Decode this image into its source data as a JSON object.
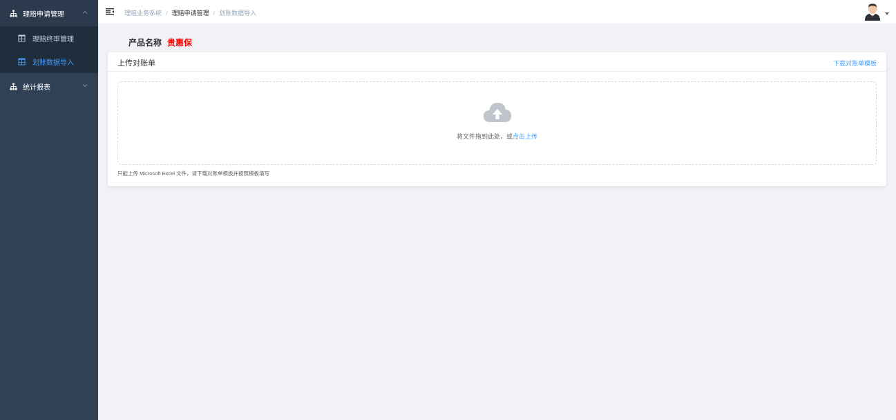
{
  "sidebar": {
    "groups": [
      {
        "label": "理赔申请管理",
        "items": [
          {
            "label": "理赔终审管理"
          },
          {
            "label": "划账数据导入"
          }
        ]
      },
      {
        "label": "统计报表"
      }
    ]
  },
  "header": {
    "breadcrumb": [
      "理赔业务系统",
      "理赔申请管理",
      "划账数据导入"
    ]
  },
  "product": {
    "label": "产品名称",
    "value": "贵惠保"
  },
  "card": {
    "title": "上传对账单",
    "download_link": "下载对账单模板",
    "drop_text": "将文件拖到此处，或",
    "drop_click": "点击上传",
    "tip": "只能上传 Microsoft Excel 文件，请下载对账单模板并按照模板填写"
  },
  "icons": {
    "menu_group": "sitemap-icon",
    "menu_item": "table-icon",
    "upload": "cloud-upload-icon",
    "toggle": "hamburger-icon",
    "avatar": "user-avatar"
  },
  "colors": {
    "sidebar_bg": "#304156",
    "submenu_bg": "#1f2d3d",
    "accent": "#409eff",
    "product_value": "#ff0000"
  }
}
